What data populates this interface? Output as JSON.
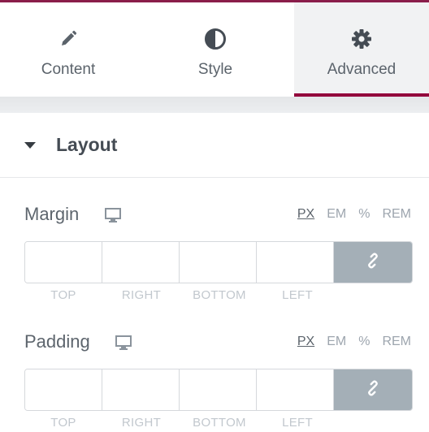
{
  "tabs": [
    {
      "label": "Content",
      "icon": "pencil-icon",
      "active": false
    },
    {
      "label": "Style",
      "icon": "contrast-icon",
      "active": false
    },
    {
      "label": "Advanced",
      "icon": "gear-icon",
      "active": true
    }
  ],
  "colors": {
    "accent": "#93003c",
    "link_button": "#a4afb7"
  },
  "section": {
    "title": "Layout"
  },
  "margin": {
    "label": "Margin",
    "units": [
      "PX",
      "EM",
      "%",
      "REM"
    ],
    "selected_unit": "PX",
    "values": {
      "top": "",
      "right": "",
      "bottom": "",
      "left": ""
    },
    "dimension_labels": [
      "TOP",
      "RIGHT",
      "BOTTOM",
      "LEFT"
    ]
  },
  "padding": {
    "label": "Padding",
    "units": [
      "PX",
      "EM",
      "%",
      "REM"
    ],
    "selected_unit": "PX",
    "values": {
      "top": "",
      "right": "",
      "bottom": "",
      "left": ""
    },
    "dimension_labels": [
      "TOP",
      "RIGHT",
      "BOTTOM",
      "LEFT"
    ]
  }
}
